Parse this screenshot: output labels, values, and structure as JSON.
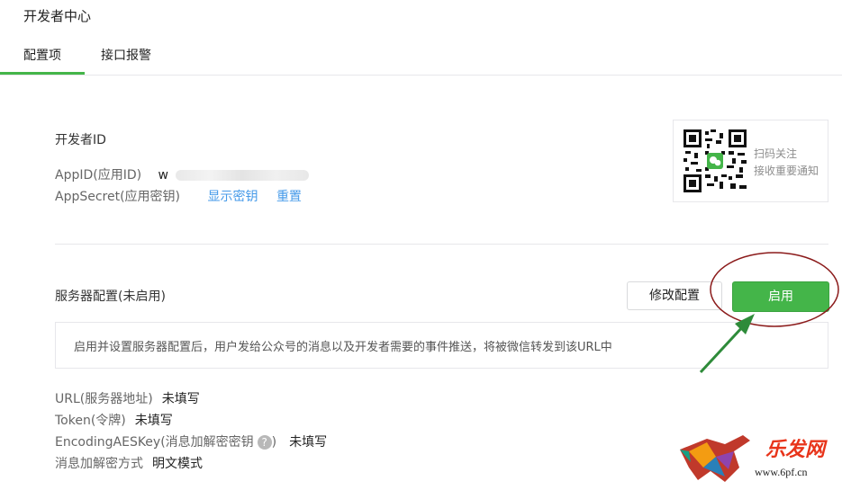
{
  "header": {
    "title": "开发者中心"
  },
  "tabs": [
    {
      "label": "配置项",
      "active": true
    },
    {
      "label": "接口报警",
      "active": false
    }
  ],
  "developer": {
    "section_title": "开发者ID",
    "appid_label": "AppID(应用ID)",
    "appid_value_visible": "w",
    "appsecret_label": "AppSecret(应用密钥)",
    "show_secret_link": "显示密钥",
    "reset_link": "重置"
  },
  "qr": {
    "line1": "扫码关注",
    "line2": "接收重要通知"
  },
  "server": {
    "section_title": "服务器配置(未启用)",
    "modify_button": "修改配置",
    "enable_button": "启用",
    "notice": "启用并设置服务器配置后，用户发给公众号的消息以及开发者需要的事件推送，将被微信转发到该URL中",
    "fields": [
      {
        "label": "URL(服务器地址)",
        "value": "未填写"
      },
      {
        "label": "Token(令牌)",
        "value": "未填写"
      },
      {
        "label": "EncodingAESKey(消息加解密密钥",
        "help": "?",
        "label_close": ")",
        "value": "未填写"
      },
      {
        "label": "消息加解密方式",
        "value": "明文模式"
      }
    ]
  },
  "watermark": {
    "title": "乐发网",
    "url": "www.6pf.cn"
  },
  "colors": {
    "accent": "#44b549",
    "link": "#459ae9",
    "annotation": "#8b1a1a",
    "arrow": "#2e8b3a"
  }
}
